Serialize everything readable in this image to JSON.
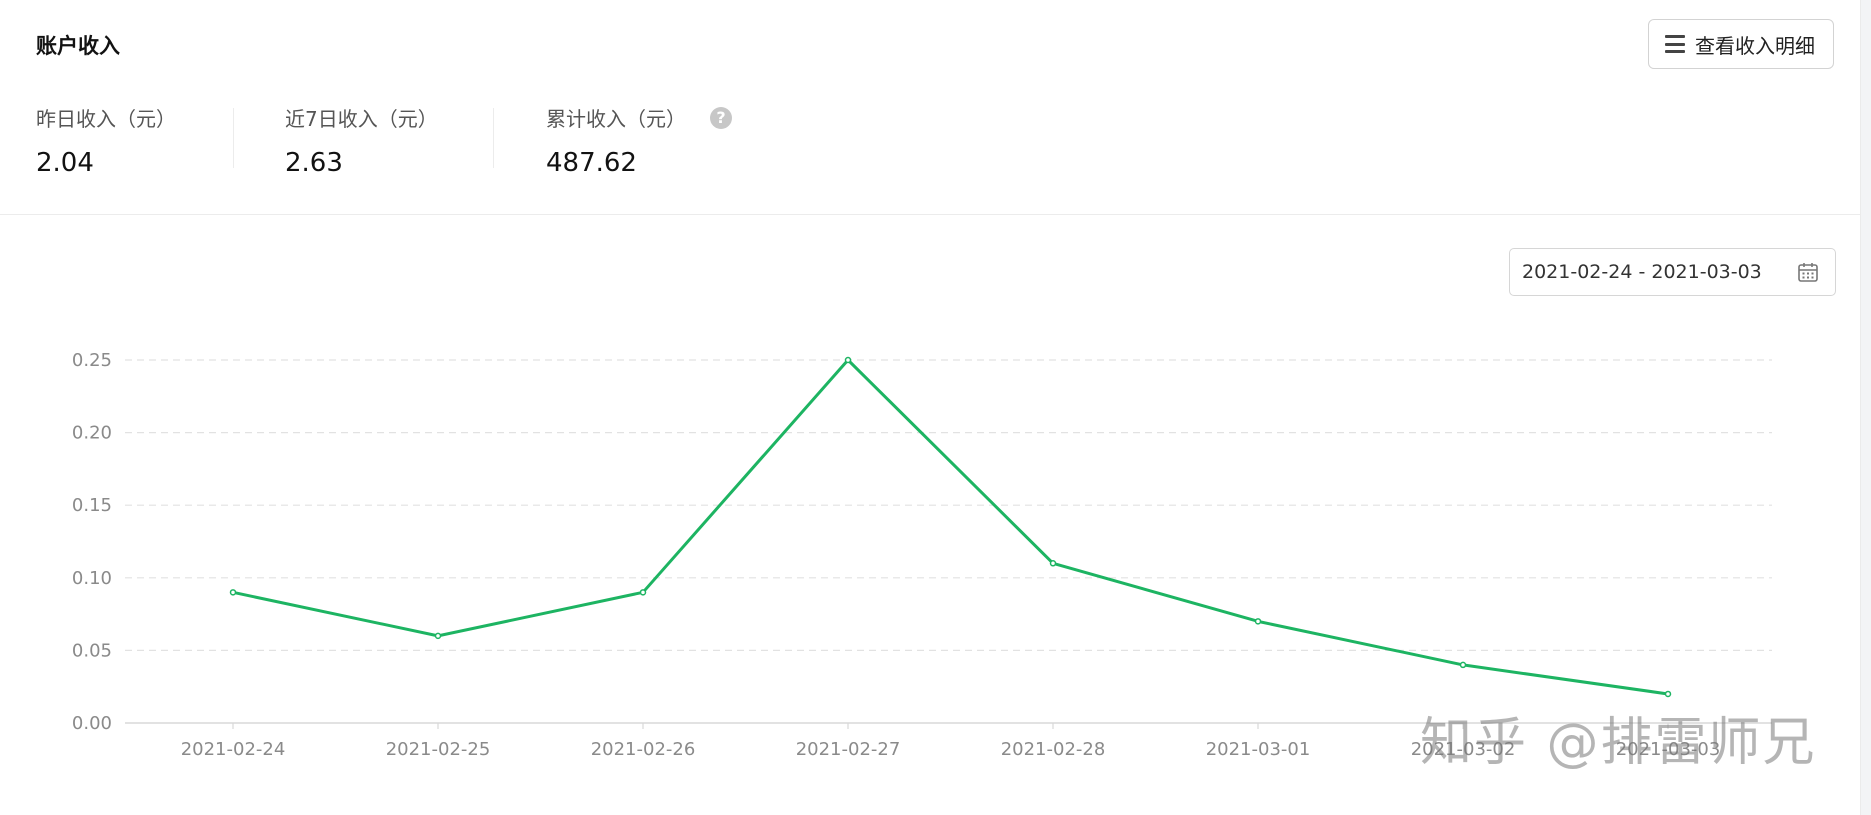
{
  "header": {
    "title": "账户收入",
    "detail_button_label": "查看收入明细"
  },
  "stats": [
    {
      "label": "昨日收入（元）",
      "value": "2.04"
    },
    {
      "label": "近7日收入（元）",
      "value": "2.63"
    },
    {
      "label": "累计收入（元）",
      "value": "487.62"
    }
  ],
  "help_icon": "question-circle-icon",
  "date_range": {
    "value": "2021-02-24 - 2021-03-03",
    "icon": "calendar-icon"
  },
  "colors": {
    "line": "#1db462",
    "grid": "#e2e2e2",
    "axis_text": "#8a8a8a"
  },
  "watermark": "知乎 @排雷师兄",
  "chart_data": {
    "type": "line",
    "categories": [
      "2021-02-24",
      "2021-02-25",
      "2021-02-26",
      "2021-02-27",
      "2021-02-28",
      "2021-03-01",
      "2021-03-02",
      "2021-03-03"
    ],
    "series": [
      {
        "values": [
          0.09,
          0.06,
          0.09,
          0.25,
          0.11,
          0.07,
          0.04,
          0.02
        ]
      }
    ],
    "yticks": [
      "0.00",
      "0.05",
      "0.10",
      "0.15",
      "0.20",
      "0.25"
    ],
    "ylim": [
      0,
      0.25
    ],
    "grid": true,
    "legend": "none"
  }
}
